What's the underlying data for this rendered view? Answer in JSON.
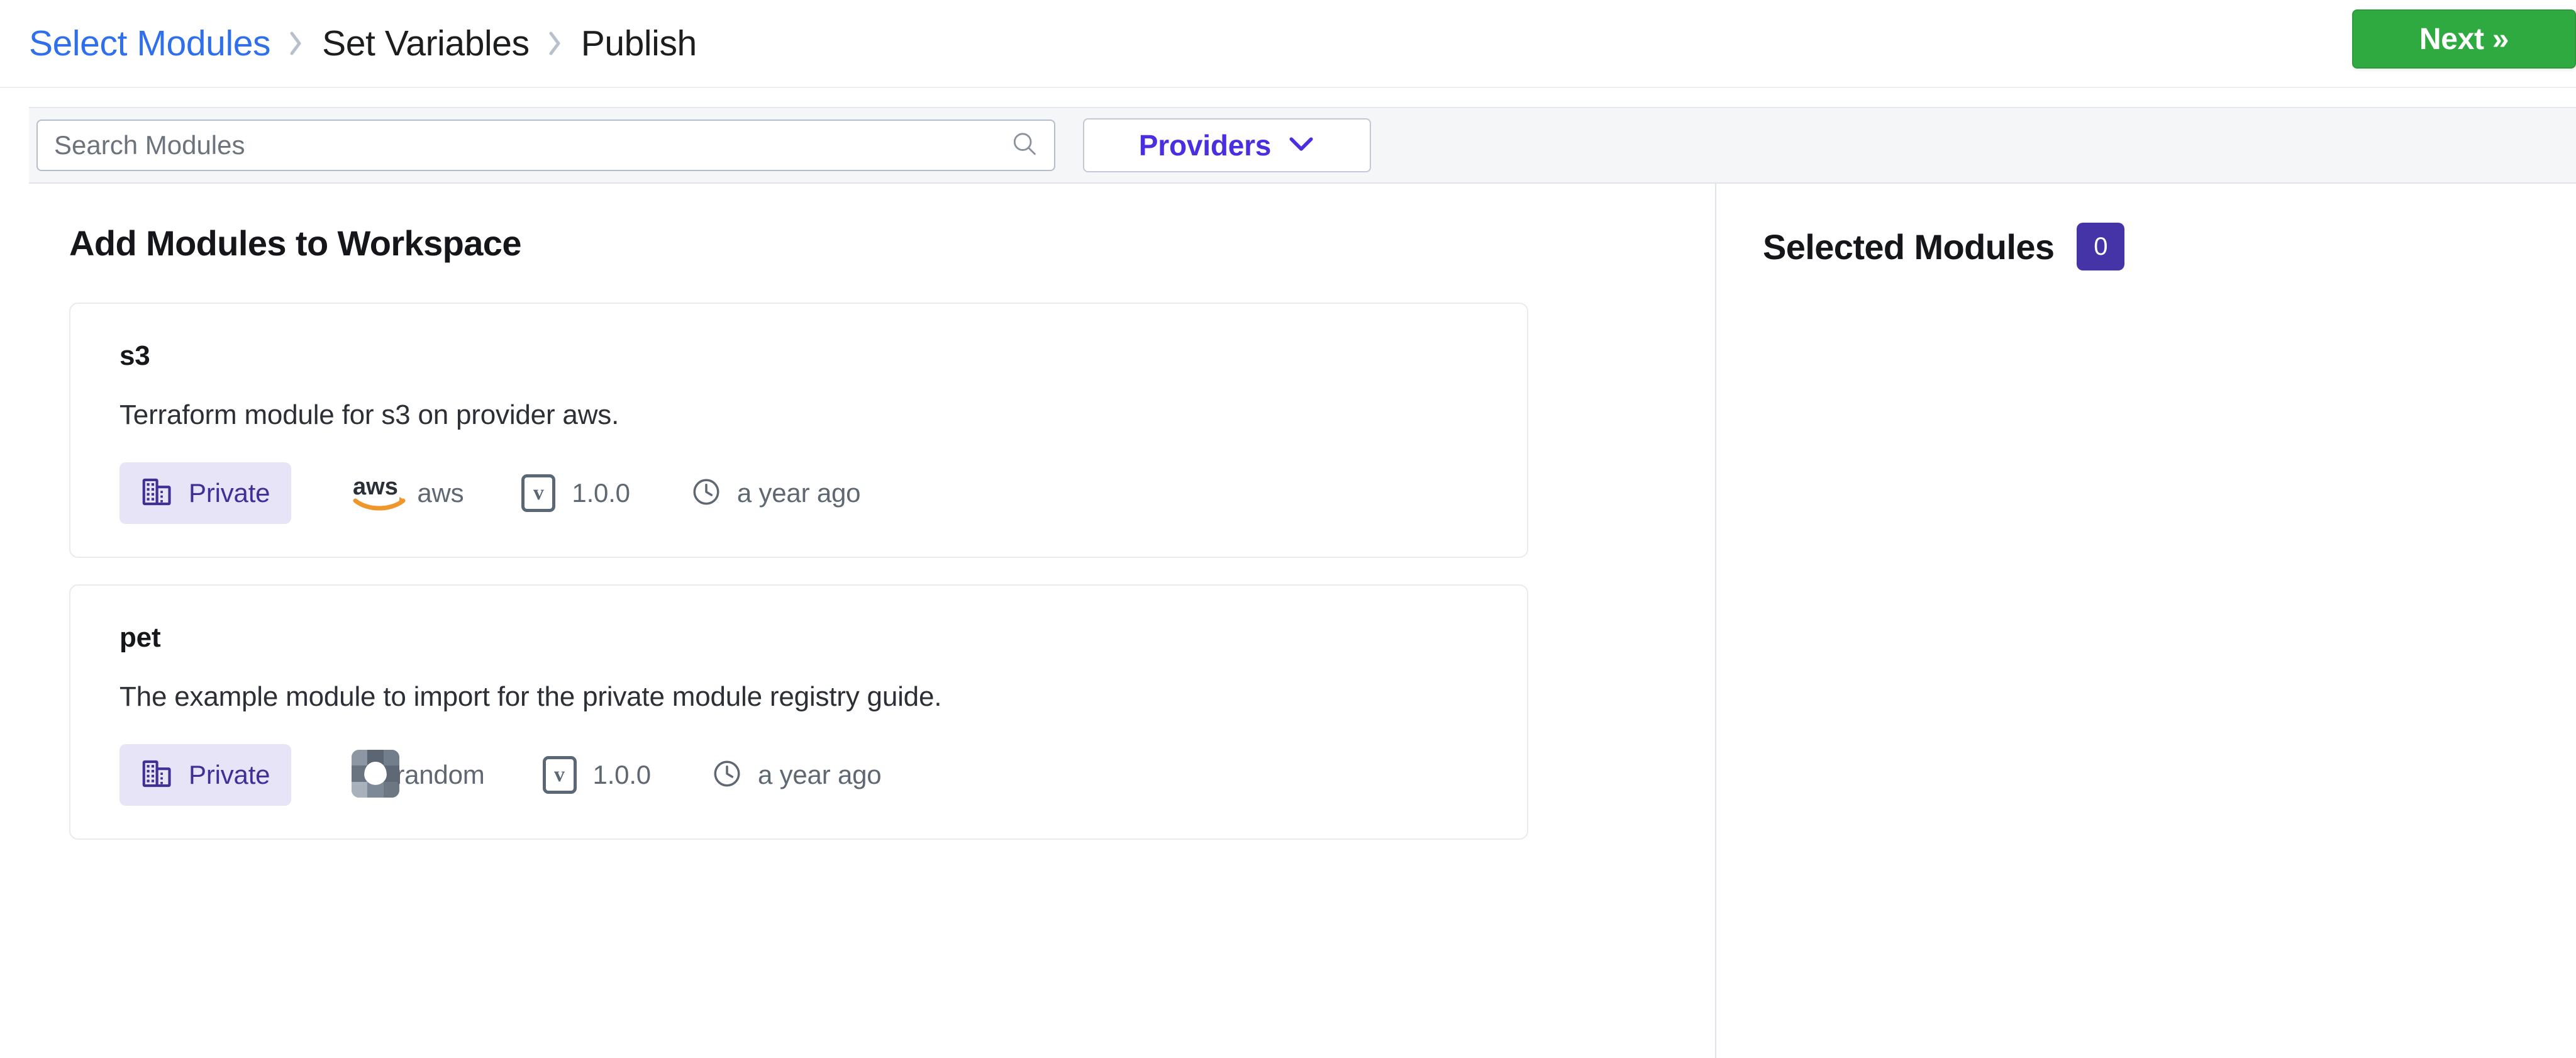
{
  "wizard": {
    "steps": [
      {
        "label": "Select Modules",
        "state": "active"
      },
      {
        "label": "Set Variables",
        "state": "plain"
      },
      {
        "label": "Publish",
        "state": "plain"
      }
    ],
    "separator": "›",
    "next_label": "Next »",
    "next_color": "#2faa41"
  },
  "toolbar": {
    "search_placeholder": "Search Modules",
    "search_value": "",
    "search_icon": "search-icon",
    "providers_label": "Providers",
    "providers_chevron": "chevron-down-icon",
    "providers_color": "#4a2fe0"
  },
  "left": {
    "title": "Add Modules to Workspace",
    "modules": [
      {
        "name": "s3",
        "description": "Terraform module for s3 on provider aws.",
        "visibility": "Private",
        "visibility_icon": "building-icon",
        "provider": "aws",
        "provider_icon": "aws-logo-icon",
        "version": "1.0.0",
        "version_icon": "version-box-icon",
        "updated": "a year ago",
        "updated_icon": "clock-icon"
      },
      {
        "name": "pet",
        "description": "The example module to import for the private module registry guide.",
        "visibility": "Private",
        "visibility_icon": "building-icon",
        "provider": "random",
        "provider_icon": "random-provider-icon",
        "version": "1.0.0",
        "version_icon": "version-box-icon",
        "updated": "a year ago",
        "updated_icon": "clock-icon"
      }
    ]
  },
  "right": {
    "title": "Selected Modules",
    "count": "0",
    "badge_color": "#4434a8"
  }
}
